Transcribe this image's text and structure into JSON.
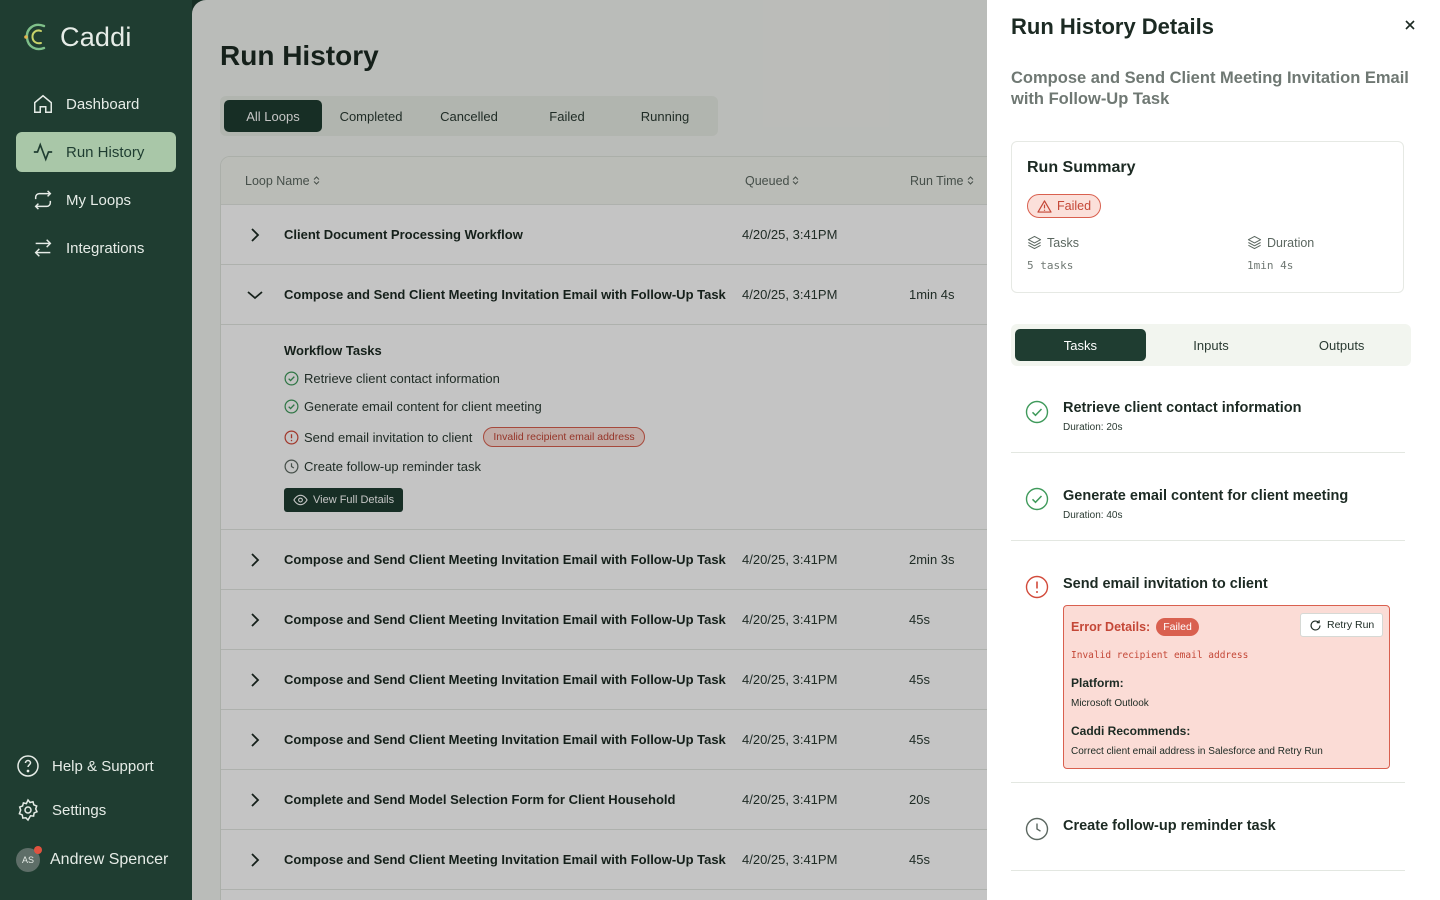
{
  "brand": {
    "name": "Caddi",
    "accent": "#1f3d31",
    "active_nav": "#a9c7a8",
    "error": "#d9604f"
  },
  "sidebar": {
    "items": [
      {
        "label": "Dashboard",
        "icon": "home-icon"
      },
      {
        "label": "Run History",
        "icon": "activity-icon",
        "active": true
      },
      {
        "label": "My Loops",
        "icon": "repeat-icon"
      },
      {
        "label": "Integrations",
        "icon": "arrows-swap-icon"
      }
    ],
    "help_label": "Help & Support",
    "settings_label": "Settings",
    "user": {
      "initials": "AS",
      "name": "Andrew Spencer"
    }
  },
  "main": {
    "title": "Run History",
    "filters": [
      "All Loops",
      "Completed",
      "Cancelled",
      "Failed",
      "Running"
    ],
    "active_filter": "All Loops",
    "columns": {
      "name": "Loop Name",
      "queued": "Queued",
      "runtime": "Run Time"
    },
    "rows": [
      {
        "name": "Client Document Processing Workflow",
        "queued": "4/20/25, 3:41PM",
        "runtime": ""
      },
      {
        "name": "Compose and Send Client Meeting Invitation Email with Follow-Up Task",
        "queued": "4/20/25, 3:41PM",
        "runtime": "1min 4s",
        "expanded": true
      },
      {
        "name": "Compose and Send Client Meeting Invitation Email with Follow-Up Task",
        "queued": "4/20/25, 3:41PM",
        "runtime": "2min 3s"
      },
      {
        "name": "Compose and Send Client Meeting Invitation Email with Follow-Up Task",
        "queued": "4/20/25, 3:41PM",
        "runtime": "45s"
      },
      {
        "name": "Compose and Send Client Meeting Invitation Email with Follow-Up Task",
        "queued": "4/20/25, 3:41PM",
        "runtime": "45s"
      },
      {
        "name": "Compose and Send Client Meeting Invitation Email with Follow-Up Task",
        "queued": "4/20/25, 3:41PM",
        "runtime": "45s"
      },
      {
        "name": "Complete and Send Model Selection Form for Client Household",
        "queued": "4/20/25, 3:41PM",
        "runtime": "20s"
      },
      {
        "name": "Compose and Send Client Meeting Invitation Email with Follow-Up Task",
        "queued": "4/20/25, 3:41PM",
        "runtime": "45s"
      }
    ],
    "expanded_detail": {
      "title": "Workflow Tasks",
      "tasks": [
        {
          "label": "Retrieve client contact information",
          "status": "success"
        },
        {
          "label": "Generate email content for client meeting",
          "status": "success"
        },
        {
          "label": "Send email invitation to client",
          "status": "error",
          "error": "Invalid recipient email address"
        },
        {
          "label": "Create follow-up reminder task",
          "status": "pending"
        }
      ],
      "view_button": "View Full Details"
    }
  },
  "drawer": {
    "title": "Run History Details",
    "subtitle": "Compose and Send Client Meeting Invitation Email with Follow-Up Task",
    "summary": {
      "title": "Run Summary",
      "status": "Failed",
      "tasks_label": "Tasks",
      "tasks_value": "5 tasks",
      "duration_label": "Duration",
      "duration_value": "1min 4s"
    },
    "tabs": [
      "Tasks",
      "Inputs",
      "Outputs"
    ],
    "active_tab": "Tasks",
    "tasks": [
      {
        "name": "Retrieve client contact information",
        "duration": "Duration: 20s",
        "status": "success"
      },
      {
        "name": "Generate email content for client meeting",
        "duration": "Duration: 40s",
        "status": "success"
      },
      {
        "name": "Send email invitation to client",
        "status": "error"
      },
      {
        "name": "Create follow-up reminder task",
        "status": "pending"
      }
    ],
    "error": {
      "title": "Error Details:",
      "badge": "Failed",
      "retry_label": "Retry Run",
      "message": "Invalid recipient email address",
      "platform_label": "Platform:",
      "platform_value": "Microsoft Outlook",
      "recommend_label": "Caddi Recommends:",
      "recommend_value": "Correct client email address in Salesforce and Retry Run"
    }
  }
}
